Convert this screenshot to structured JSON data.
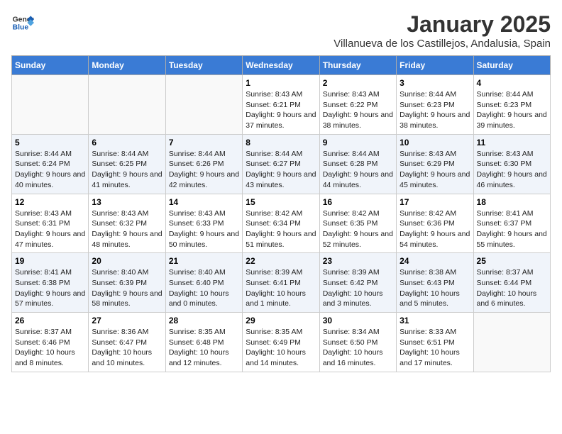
{
  "header": {
    "logo_line1": "General",
    "logo_line2": "Blue",
    "title": "January 2025",
    "subtitle": "Villanueva de los Castillejos, Andalusia, Spain"
  },
  "weekdays": [
    "Sunday",
    "Monday",
    "Tuesday",
    "Wednesday",
    "Thursday",
    "Friday",
    "Saturday"
  ],
  "weeks": [
    [
      {
        "day": "",
        "info": ""
      },
      {
        "day": "",
        "info": ""
      },
      {
        "day": "",
        "info": ""
      },
      {
        "day": "1",
        "info": "Sunrise: 8:43 AM\nSunset: 6:21 PM\nDaylight: 9 hours and 37 minutes."
      },
      {
        "day": "2",
        "info": "Sunrise: 8:43 AM\nSunset: 6:22 PM\nDaylight: 9 hours and 38 minutes."
      },
      {
        "day": "3",
        "info": "Sunrise: 8:44 AM\nSunset: 6:23 PM\nDaylight: 9 hours and 38 minutes."
      },
      {
        "day": "4",
        "info": "Sunrise: 8:44 AM\nSunset: 6:23 PM\nDaylight: 9 hours and 39 minutes."
      }
    ],
    [
      {
        "day": "5",
        "info": "Sunrise: 8:44 AM\nSunset: 6:24 PM\nDaylight: 9 hours and 40 minutes."
      },
      {
        "day": "6",
        "info": "Sunrise: 8:44 AM\nSunset: 6:25 PM\nDaylight: 9 hours and 41 minutes."
      },
      {
        "day": "7",
        "info": "Sunrise: 8:44 AM\nSunset: 6:26 PM\nDaylight: 9 hours and 42 minutes."
      },
      {
        "day": "8",
        "info": "Sunrise: 8:44 AM\nSunset: 6:27 PM\nDaylight: 9 hours and 43 minutes."
      },
      {
        "day": "9",
        "info": "Sunrise: 8:44 AM\nSunset: 6:28 PM\nDaylight: 9 hours and 44 minutes."
      },
      {
        "day": "10",
        "info": "Sunrise: 8:43 AM\nSunset: 6:29 PM\nDaylight: 9 hours and 45 minutes."
      },
      {
        "day": "11",
        "info": "Sunrise: 8:43 AM\nSunset: 6:30 PM\nDaylight: 9 hours and 46 minutes."
      }
    ],
    [
      {
        "day": "12",
        "info": "Sunrise: 8:43 AM\nSunset: 6:31 PM\nDaylight: 9 hours and 47 minutes."
      },
      {
        "day": "13",
        "info": "Sunrise: 8:43 AM\nSunset: 6:32 PM\nDaylight: 9 hours and 48 minutes."
      },
      {
        "day": "14",
        "info": "Sunrise: 8:43 AM\nSunset: 6:33 PM\nDaylight: 9 hours and 50 minutes."
      },
      {
        "day": "15",
        "info": "Sunrise: 8:42 AM\nSunset: 6:34 PM\nDaylight: 9 hours and 51 minutes."
      },
      {
        "day": "16",
        "info": "Sunrise: 8:42 AM\nSunset: 6:35 PM\nDaylight: 9 hours and 52 minutes."
      },
      {
        "day": "17",
        "info": "Sunrise: 8:42 AM\nSunset: 6:36 PM\nDaylight: 9 hours and 54 minutes."
      },
      {
        "day": "18",
        "info": "Sunrise: 8:41 AM\nSunset: 6:37 PM\nDaylight: 9 hours and 55 minutes."
      }
    ],
    [
      {
        "day": "19",
        "info": "Sunrise: 8:41 AM\nSunset: 6:38 PM\nDaylight: 9 hours and 57 minutes."
      },
      {
        "day": "20",
        "info": "Sunrise: 8:40 AM\nSunset: 6:39 PM\nDaylight: 9 hours and 58 minutes."
      },
      {
        "day": "21",
        "info": "Sunrise: 8:40 AM\nSunset: 6:40 PM\nDaylight: 10 hours and 0 minutes."
      },
      {
        "day": "22",
        "info": "Sunrise: 8:39 AM\nSunset: 6:41 PM\nDaylight: 10 hours and 1 minute."
      },
      {
        "day": "23",
        "info": "Sunrise: 8:39 AM\nSunset: 6:42 PM\nDaylight: 10 hours and 3 minutes."
      },
      {
        "day": "24",
        "info": "Sunrise: 8:38 AM\nSunset: 6:43 PM\nDaylight: 10 hours and 5 minutes."
      },
      {
        "day": "25",
        "info": "Sunrise: 8:37 AM\nSunset: 6:44 PM\nDaylight: 10 hours and 6 minutes."
      }
    ],
    [
      {
        "day": "26",
        "info": "Sunrise: 8:37 AM\nSunset: 6:46 PM\nDaylight: 10 hours and 8 minutes."
      },
      {
        "day": "27",
        "info": "Sunrise: 8:36 AM\nSunset: 6:47 PM\nDaylight: 10 hours and 10 minutes."
      },
      {
        "day": "28",
        "info": "Sunrise: 8:35 AM\nSunset: 6:48 PM\nDaylight: 10 hours and 12 minutes."
      },
      {
        "day": "29",
        "info": "Sunrise: 8:35 AM\nSunset: 6:49 PM\nDaylight: 10 hours and 14 minutes."
      },
      {
        "day": "30",
        "info": "Sunrise: 8:34 AM\nSunset: 6:50 PM\nDaylight: 10 hours and 16 minutes."
      },
      {
        "day": "31",
        "info": "Sunrise: 8:33 AM\nSunset: 6:51 PM\nDaylight: 10 hours and 17 minutes."
      },
      {
        "day": "",
        "info": ""
      }
    ]
  ]
}
